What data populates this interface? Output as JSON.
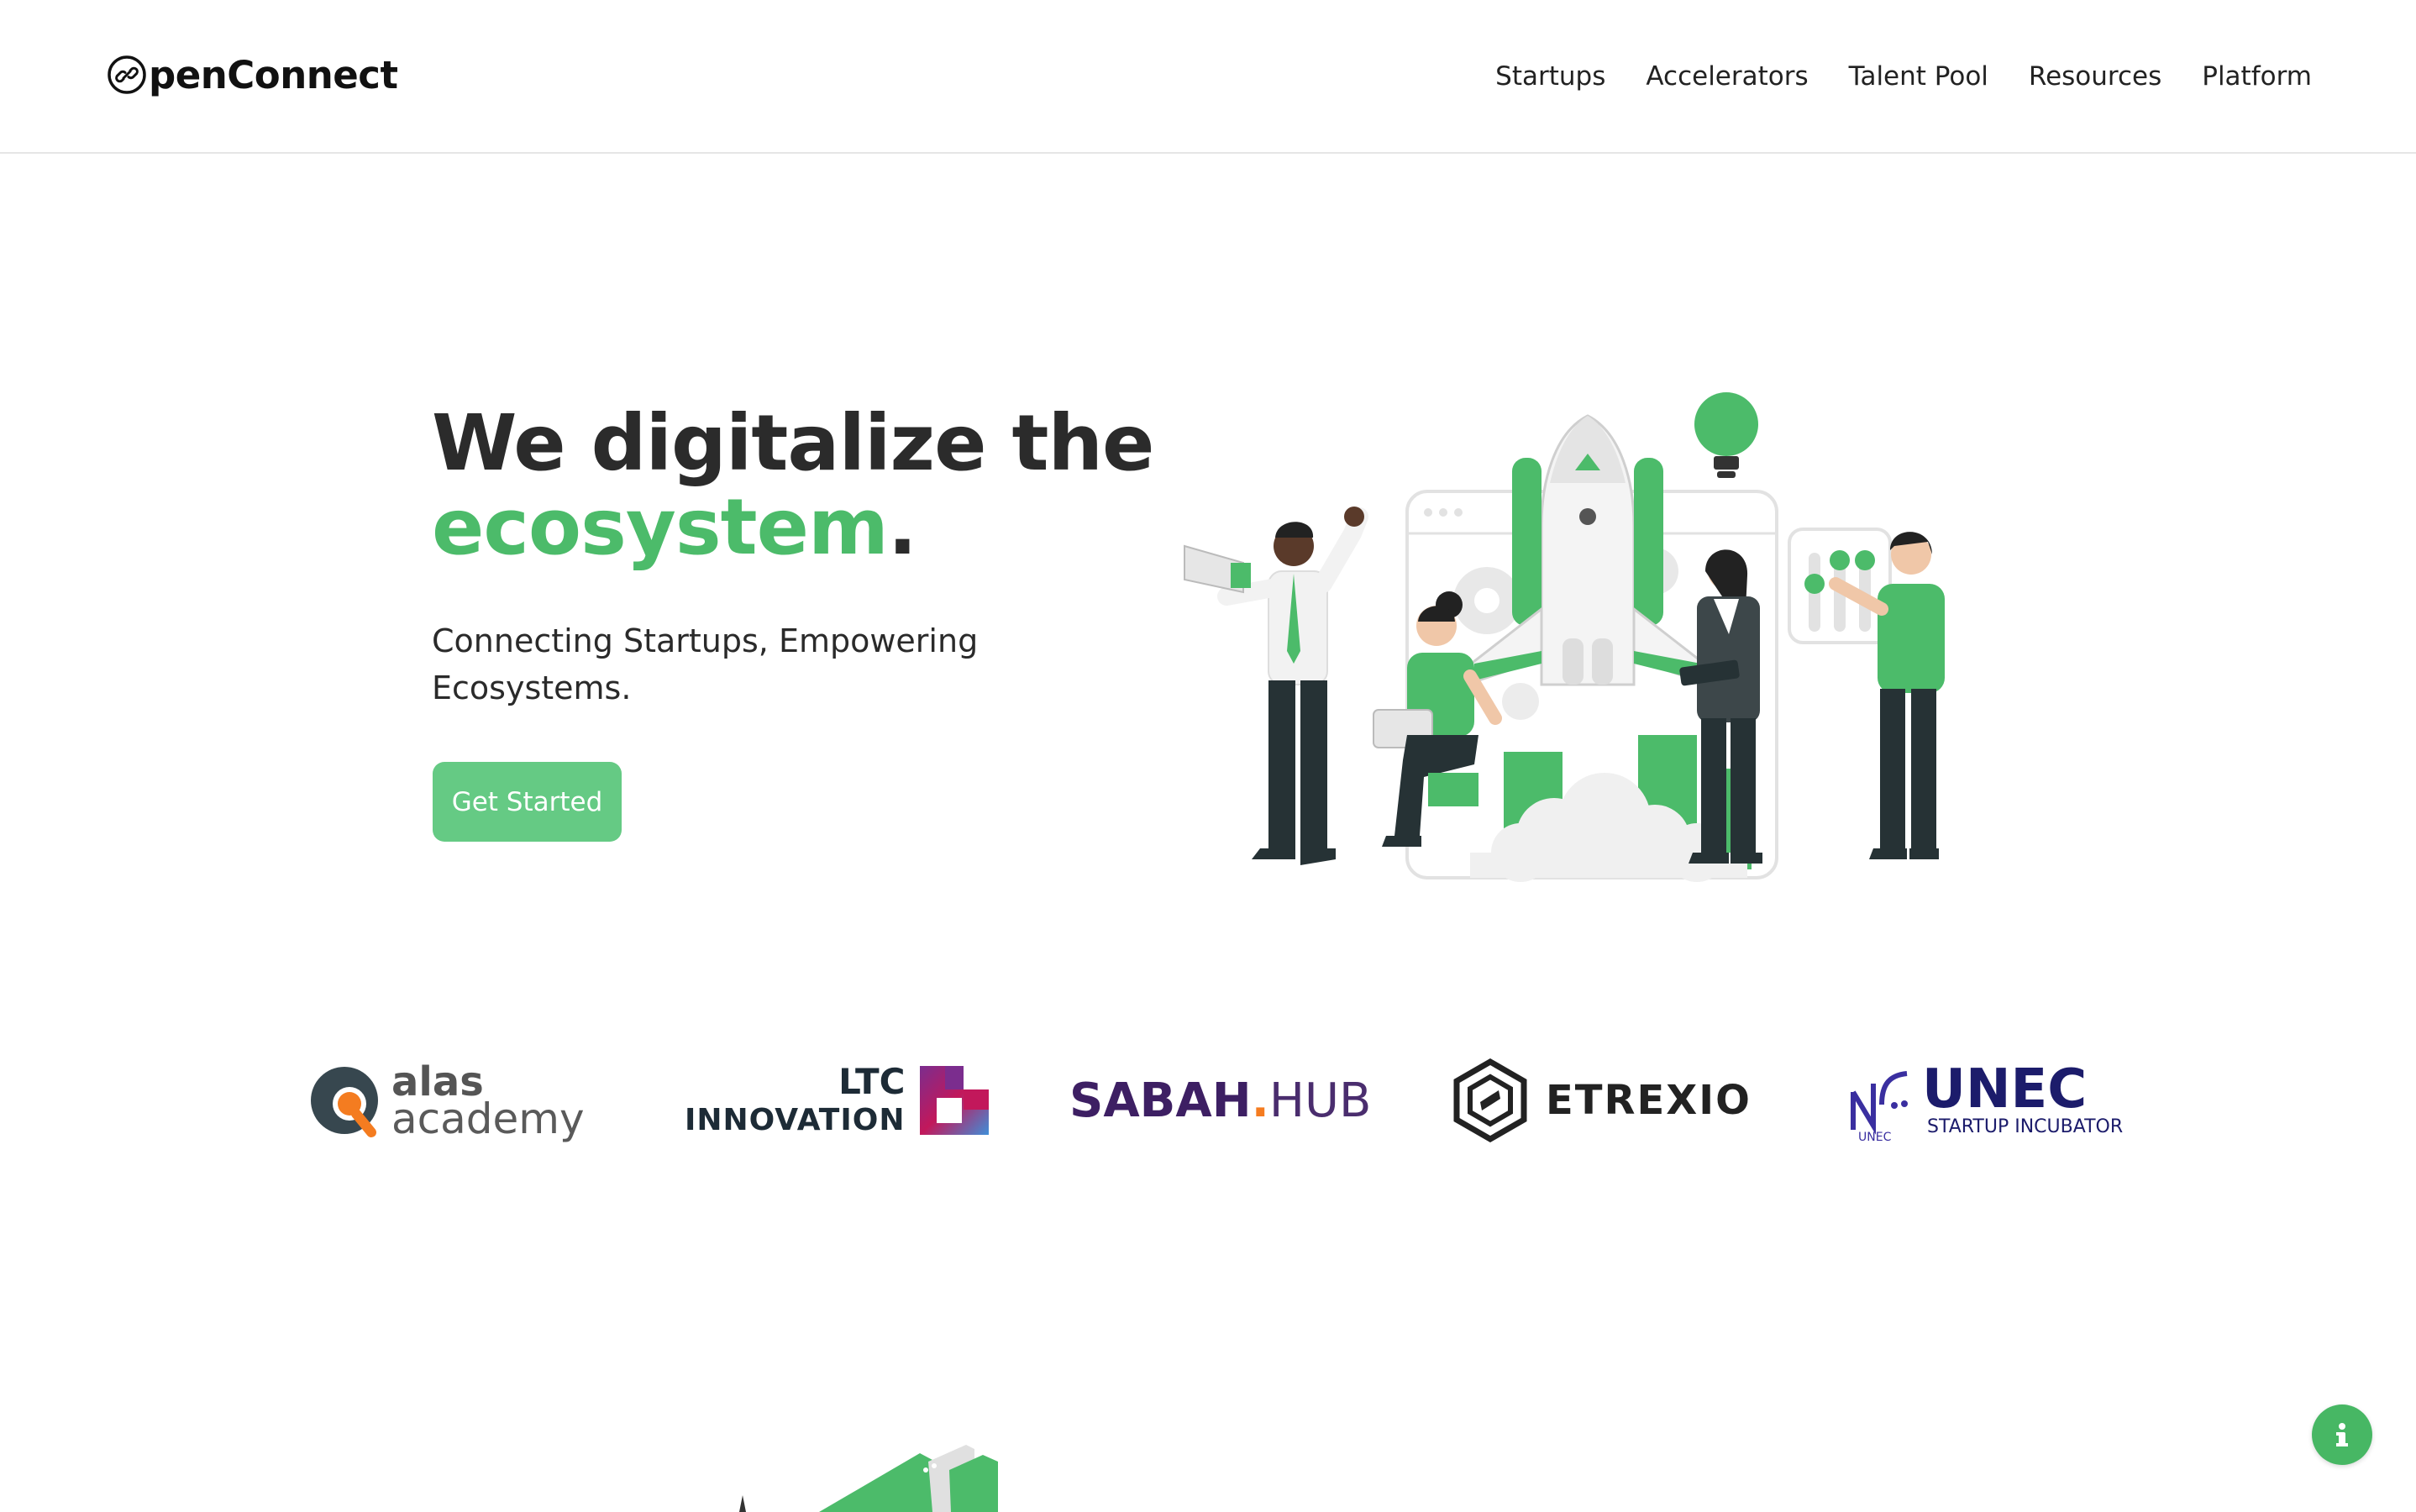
{
  "brand": {
    "name": "penConnect",
    "logo_icon": "link-circle-icon"
  },
  "nav": {
    "items": [
      {
        "label": "Startups"
      },
      {
        "label": "Accelerators"
      },
      {
        "label": "Talent Pool"
      },
      {
        "label": "Resources"
      },
      {
        "label": "Platform"
      }
    ]
  },
  "hero": {
    "title_line1": "We digitalize the",
    "title_highlight": "ecosystem",
    "title_period": ".",
    "subtitle": "Connecting Startups, Empowering Ecosystems.",
    "cta_label": "Get Started"
  },
  "partners": {
    "alas": {
      "line1": "alas",
      "line2": "academy"
    },
    "ltc": {
      "line1": "LTC",
      "line2": "INNOVATION"
    },
    "sabah": {
      "part1": "SABAH",
      "dot": ".",
      "part2": "HUB"
    },
    "etrexio": {
      "label": "ETREXIO"
    },
    "unec": {
      "line1": "UNEC",
      "line2": "STARTUP INCUBATOR",
      "mark_small": "UNEC"
    }
  },
  "colors": {
    "accent": "#4cbb6a",
    "button": "#65ca84",
    "text": "#2b2b2b"
  },
  "fab": {
    "icon": "info-icon"
  }
}
